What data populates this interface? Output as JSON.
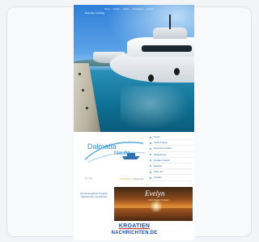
{
  "hero": {
    "site_title": "Dalmatia Yachting",
    "menu": [
      "Home",
      "Charter",
      "Yachts",
      "Destinations",
      "Contact"
    ]
  },
  "logo": {
    "word1": "Dalmatia",
    "word2": "Nautic"
  },
  "side_nav": {
    "items": [
      "Home",
      "Yacht-Charter",
      "Motorboot Charter",
      "Skippertörns",
      "Kroatien Urlaub",
      "Marinas",
      "Über uns",
      "Kontakt"
    ]
  },
  "rating": {
    "stars": "★★★★☆",
    "caption": "Bewertung",
    "note": "Anzeige"
  },
  "ad": {
    "text": "Sonderangebote Kroatien Yachtcharter Last Minute",
    "photo_title": "Evelyn",
    "photo_subtitle": "Yacht Charter Kroatien"
  },
  "banner": {
    "line1": "KROATIEN",
    "line2": "NACHRICHTEN.DE"
  }
}
